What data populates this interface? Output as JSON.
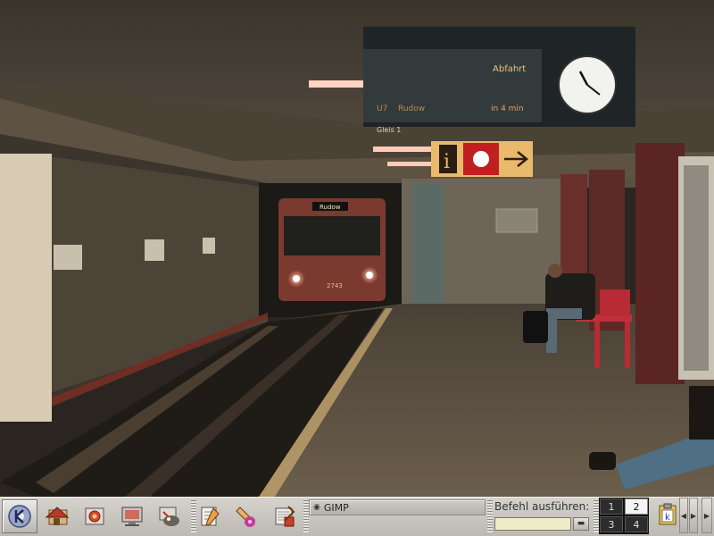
{
  "wallpaper": {
    "display_board": {
      "header": "Abfahrt",
      "line": "U7",
      "destination": "Rudow",
      "eta": "in 4 min",
      "track": "Gleis 1"
    },
    "train_destination": "Rudow",
    "train_number": "2743"
  },
  "panel": {
    "launchers": [
      {
        "name": "k-menu",
        "icon": "k-gear-icon"
      },
      {
        "name": "home",
        "icon": "home-folder-icon"
      },
      {
        "name": "control-center",
        "icon": "control-center-icon"
      },
      {
        "name": "desktop",
        "icon": "desktop-monitor-icon"
      },
      {
        "name": "gimp",
        "icon": "gimp-icon"
      },
      {
        "name": "text-editor",
        "icon": "editor-icon"
      },
      {
        "name": "paint",
        "icon": "paint-icon"
      },
      {
        "name": "office",
        "icon": "office-icon"
      }
    ],
    "taskbar": {
      "items": [
        {
          "label": "GIMP"
        }
      ]
    },
    "run_command": {
      "label": "Befehl ausführen:",
      "value": ""
    },
    "pager": {
      "desktops": [
        "1",
        "2",
        "3",
        "4"
      ],
      "active": "2"
    }
  }
}
